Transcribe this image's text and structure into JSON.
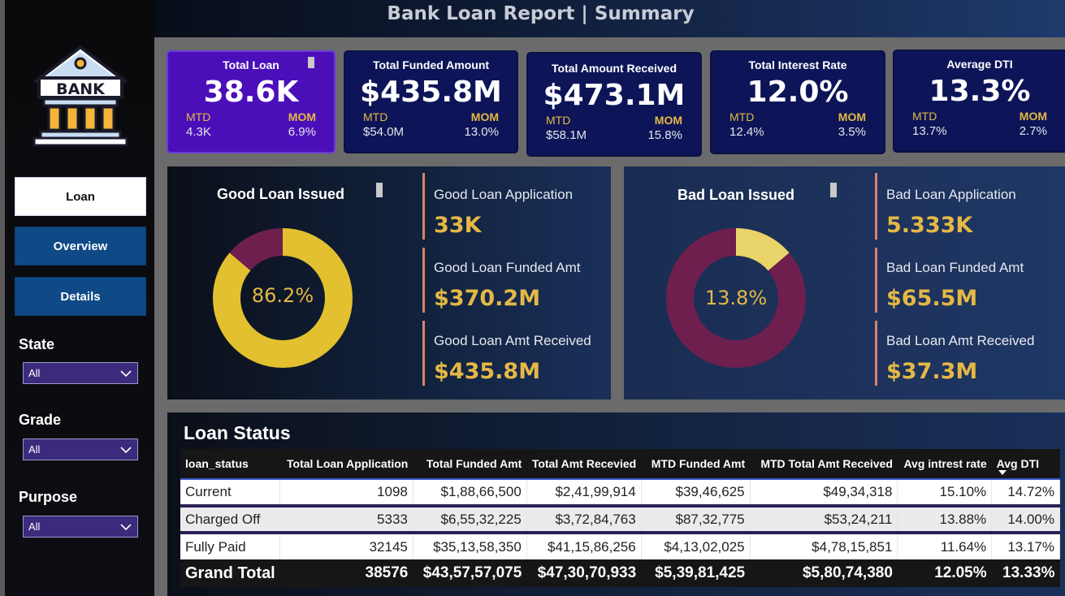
{
  "header": {
    "title": "Bank Loan Report | Summary"
  },
  "sidebar": {
    "logo_text": "BANK",
    "nav": [
      {
        "label": "Loan",
        "active": true
      },
      {
        "label": "Overview",
        "active": false
      },
      {
        "label": "Details",
        "active": false
      }
    ],
    "filters": [
      {
        "label": "State",
        "value": "All"
      },
      {
        "label": "Grade",
        "value": "All"
      },
      {
        "label": "Purpose",
        "value": "All"
      }
    ]
  },
  "kpis": [
    {
      "title": "Total Loan",
      "value": "38.6K",
      "mtd_label": "MTD",
      "mom_label": "MOM",
      "mtd": "4.3K",
      "mom": "6.9%"
    },
    {
      "title": "Total Funded Amount",
      "value": "$435.8M",
      "mtd_label": "MTD",
      "mom_label": "MOM",
      "mtd": "$54.0M",
      "mom": "13.0%"
    },
    {
      "title": "Total Amount Received",
      "value": "$473.1M",
      "mtd_label": "MTD",
      "mom_label": "MOM",
      "mtd": "$58.1M",
      "mom": "15.8%"
    },
    {
      "title": "Total Interest Rate",
      "value": "12.0%",
      "mtd_label": "MTD",
      "mom_label": "MOM",
      "mtd": "12.4%",
      "mom": "3.5%"
    },
    {
      "title": "Average DTI",
      "value": "13.3%",
      "mtd_label": "MTD",
      "mom_label": "MOM",
      "mtd": "13.7%",
      "mom": "2.7%"
    }
  ],
  "good_loan": {
    "title": "Good Loan Issued",
    "percent_label": "86.2%",
    "percent": 86.2,
    "metrics": [
      {
        "label": "Good Loan Application",
        "value": "33K"
      },
      {
        "label": "Good Loan Funded Amt",
        "value": "$370.2M"
      },
      {
        "label": "Good Loan Amt Received",
        "value": "$435.8M"
      }
    ]
  },
  "bad_loan": {
    "title": "Bad Loan Issued",
    "percent_label": "13.8%",
    "percent": 13.8,
    "metrics": [
      {
        "label": "Bad Loan Application",
        "value": "5.333K"
      },
      {
        "label": "Bad Loan Funded Amt",
        "value": "$65.5M"
      },
      {
        "label": "Bad Loan Amt Received",
        "value": "$37.3M"
      }
    ]
  },
  "colors": {
    "good": "#e2c02f",
    "bad": "#6e1f4e",
    "bad_light": "#e9d46a",
    "accent_yellow": "#e4b844"
  },
  "loan_status": {
    "title": "Loan Status",
    "columns": [
      "loan_status",
      "Total Loan Application",
      "Total Funded Amt",
      "Total Amt Recevied",
      "MTD Funded Amt",
      "MTD Total Amt Received",
      "Avg intrest rate",
      "Avg DTI"
    ],
    "rows": [
      [
        "Current",
        "1098",
        "$1,88,66,500",
        "$2,41,99,914",
        "$39,46,625",
        "$49,34,318",
        "15.10%",
        "14.72%"
      ],
      [
        "Charged Off",
        "5333",
        "$6,55,32,225",
        "$3,72,84,763",
        "$87,32,775",
        "$53,24,211",
        "13.88%",
        "14.00%"
      ],
      [
        "Fully Paid",
        "32145",
        "$35,13,58,350",
        "$41,15,86,256",
        "$4,13,02,025",
        "$4,78,15,851",
        "11.64%",
        "13.17%"
      ]
    ],
    "total": [
      "Grand Total",
      "38576",
      "$43,57,57,075",
      "$47,30,70,933",
      "$5,39,81,425",
      "$5,80,74,380",
      "12.05%",
      "13.33%"
    ]
  }
}
